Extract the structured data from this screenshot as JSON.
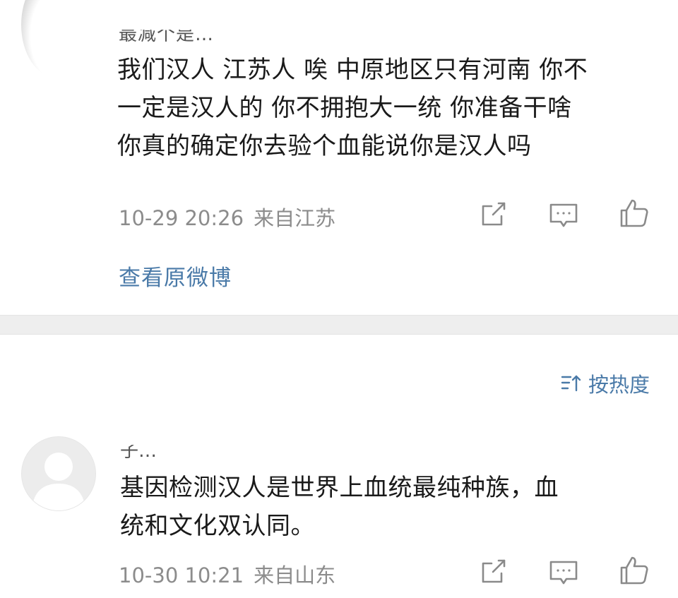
{
  "comments": [
    {
      "username": "最减个是…",
      "text_lines": [
        "我们汉人 江苏人 唉 中原地区只有河南 你不",
        "一定是汉人的 你不拥抱大一统 你准备干啥",
        "你真的确定你去验个血能说你是汉人吗"
      ],
      "time": "10-29 20:26",
      "location": "来自江苏",
      "view_original": "查看原微博"
    },
    {
      "username": "子…",
      "text_lines": [
        "基因检测汉人是世界上血统最纯种族，血",
        "统和文化双认同。"
      ],
      "time": "10-30 10:21",
      "location": "来自山东"
    }
  ],
  "sort": {
    "label": "按热度",
    "icon": "sort-icon"
  },
  "actions": {
    "share_icon": "share-icon",
    "comment_icon": "comment-icon",
    "like_icon": "like-icon"
  },
  "colors": {
    "link": "#4a7aa8",
    "meta": "#8c8c8c",
    "text": "#1a1a1a",
    "divider": "#eeeeee"
  }
}
